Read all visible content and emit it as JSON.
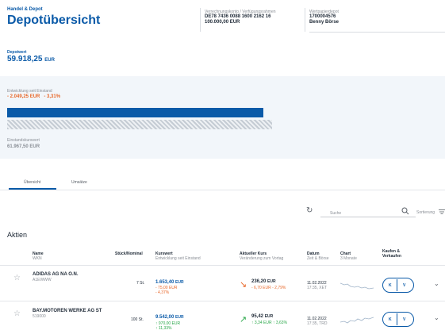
{
  "header": {
    "kicker": "Handel & Depot",
    "title": "Depotübersicht",
    "account_label": "Verrechnungskonto / Verfügungsrahmen",
    "account_iban": "DE78 7436 0088 1600 2162 16",
    "account_amount": "100.000,00 EUR",
    "depot_label": "Wertpapierdepot",
    "depot_number": "1700004576",
    "depot_owner": "Benny Börse"
  },
  "summary": {
    "depotwert_label": "Depotwert",
    "depotwert_value": "59.918,25",
    "depotwert_currency": "EUR",
    "entwicklung_label": "Entwicklung seit Einstand",
    "entwicklung_abs": "- 2.049,25 EUR",
    "entwicklung_pct": "- 3,31%",
    "current_fraction": 0.967,
    "einstandskurs_label": "Einstandskurswert",
    "einstandskurs_value": "61.967,50 EUR"
  },
  "tabs": [
    {
      "label": "Übersicht",
      "active": true
    },
    {
      "label": "Umsätze",
      "active": false
    }
  ],
  "toolbar": {
    "search_placeholder": "Suche",
    "sort_label": "Sortierung"
  },
  "section_title": "Aktien",
  "columns": {
    "name": "Name",
    "name_sub": "WKN",
    "stueck": "Stück/Nominal",
    "kurswert": "Kurswert",
    "kurswert_sub": "Entwicklung seit Einstand",
    "kurs": "Aktueller Kurs",
    "kurs_sub": "Veränderung zum Vortag",
    "datum": "Datum",
    "datum_sub": "Zeit & Börse",
    "chart": "Chart",
    "chart_sub": "3 Monate",
    "kaufen": "Kaufen &",
    "kaufen2": "Verkaufen"
  },
  "rows": [
    {
      "name": "ADIDAS AG NA O.N.",
      "wkn": "A1EWWW",
      "stueck": "7 St.",
      "kurswert": "1.653,40",
      "kurswert_cur": "EUR",
      "kurswert_abs": "- 75,00 EUR",
      "kurswert_pct": "- 4,37%",
      "kurs": "236,20",
      "kurs_cur": "EUR",
      "kurs_change": "- 6,70 EUR  - 2,79%",
      "datum": "11.02.2022",
      "zeit": "17:35, XET",
      "buy": "K",
      "sell": "V",
      "trend": "down"
    },
    {
      "name": "BAY.MOTOREN WERKE AG ST",
      "wkn": "519000",
      "stueck": "100 St.",
      "kurswert": "9.542,00",
      "kurswert_cur": "EUR",
      "kurswert_abs": "↑ 970,00 EUR",
      "kurswert_pct": "↑ 11,33%",
      "kurs": "95,42",
      "kurs_cur": "EUR",
      "kurs_change": "↑ 3,34 EUR  ↑ 3,63%",
      "datum": "11.02.2022",
      "zeit": "17:35, TRD",
      "buy": "K",
      "sell": "V",
      "trend": "up"
    }
  ]
}
